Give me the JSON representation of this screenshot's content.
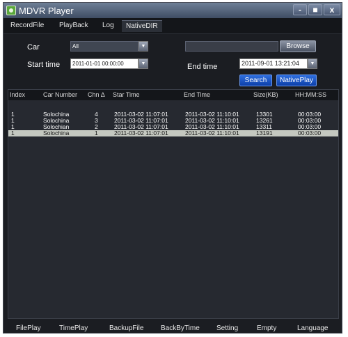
{
  "window": {
    "title": "MDVR Player"
  },
  "window_buttons": {
    "minimize": "-",
    "maximize": "■",
    "close": "x"
  },
  "menu": [
    "RecordFile",
    "PlayBack",
    "Log",
    "NativeDIR"
  ],
  "filters": {
    "car_label": "Car",
    "car_value": "All",
    "start_label": "Start time",
    "start_value": "2011-01-01 00:00:00",
    "end_label": "End time",
    "end_value": "2011-09-01 13:21:04",
    "path_value": "",
    "browse_label": "Browse",
    "search_label": "Search",
    "nativeplay_label": "NativePlay"
  },
  "table": {
    "columns": [
      "Index",
      "Car Number",
      "Chn ∆",
      "Star Time",
      "End Time",
      "Size(KB)",
      "HH:MM:SS"
    ],
    "rows": [
      [
        "1",
        "Solochina",
        "4",
        "2011-03-02  11:07:01",
        "2011-03-02  11:10:01",
        "13301",
        "00:03:00"
      ],
      [
        "1",
        "Solochina",
        "3",
        "2011-03-02  11:07:01",
        "2011-03-02  11:10:01",
        "13261",
        "00:03:00"
      ],
      [
        "1",
        "Solochian",
        "2",
        "2011-03-02  11:07:01",
        "2011-03-02  11:10:01",
        "13311",
        "00:03:00"
      ],
      [
        "1",
        "Solochina",
        "1",
        "2011-03-02  11:07:01",
        "2011-03-02  11:10:01",
        "13191",
        "00:03:00"
      ]
    ],
    "selected_row": 4
  },
  "bottom": [
    "FilePlay",
    "TimePlay",
    "BackupFile",
    "BackByTime",
    "Setting",
    "Empty",
    "Language"
  ],
  "colors": {
    "accent_blue": "#1a55c8",
    "window_bg": "#1b1d22",
    "selected_row": "#c4c8c0"
  }
}
